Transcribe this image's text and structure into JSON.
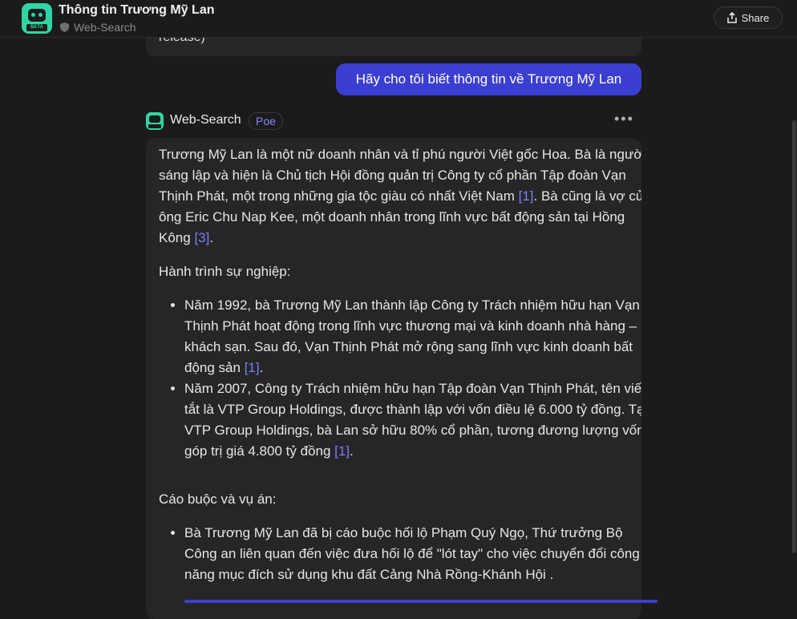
{
  "header": {
    "title": "Thông tin Trương Mỹ Lan",
    "subtitle": "Web-Search",
    "share_label": "Share",
    "logo_badge": "BETA"
  },
  "previous_message": {
    "tail_text": "release)"
  },
  "user_message": {
    "text": "Hãy cho tôi biết thông tin về Trương Mỹ Lan"
  },
  "bot": {
    "name": "Web-Search",
    "badge": "Poe",
    "more_label": "•••"
  },
  "answer": {
    "intro": {
      "t1": "Trương Mỹ Lan là một nữ doanh nhân và tỉ phú người Việt gốc Hoa. Bà là người sáng lập và hiện là Chủ tịch Hội đồng quản trị Công ty cổ phần Tập đoàn Vạn Thịnh Phát, một trong những gia tộc giàu có nhất Việt Nam ",
      "c1": "[1]",
      "t2": ". Bà cũng là vợ của ông Eric Chu Nap Kee, một doanh nhân trong lĩnh vực bất động sản tại Hồng Kông ",
      "c2": "[3]",
      "t3": "."
    },
    "career_heading": "Hành trình sự nghiệp:",
    "career_items": [
      {
        "text": "Năm 1992, bà Trương Mỹ Lan thành lập Công ty Trách nhiệm hữu hạn Vạn Thịnh Phát hoạt động trong lĩnh vực thương mại và kinh doanh nhà hàng – khách sạn. Sau đó, Vạn Thịnh Phát mở rộng sang lĩnh vực kinh doanh bất động sản ",
        "cite": "[1]",
        "end": "."
      },
      {
        "text": "Năm 2007, Công ty Trách nhiệm hữu hạn Tập đoàn Vạn Thịnh Phát, tên viết tắt là VTP Group Holdings, được thành lập với vốn điều lệ 6.000 tỷ đồng. Tại VTP Group Holdings, bà Lan sở hữu 80% cổ phần, tương đương lượng vốn góp trị giá 4.800 tỷ đồng ",
        "cite": "[1]",
        "end": "."
      }
    ],
    "charges_heading": "Cáo buộc và vụ án:",
    "charges_items": [
      {
        "text": "Bà Trương Mỹ Lan đã bị cáo buộc hối lộ Phạm Quý Ngọ, Thứ trưởng Bộ Công an liên quan đến việc đưa hối lộ để \"lót tay\" cho việc chuyển đổi công năng mục đích sử dụng khu đất Cảng Nhà Rồng-Khánh Hội ."
      }
    ]
  },
  "colors": {
    "background": "#1b1b1b",
    "bubble": "#262626",
    "accent": "#3b3fd1",
    "link": "#7f7cff",
    "brand": "#2fd6a3"
  }
}
